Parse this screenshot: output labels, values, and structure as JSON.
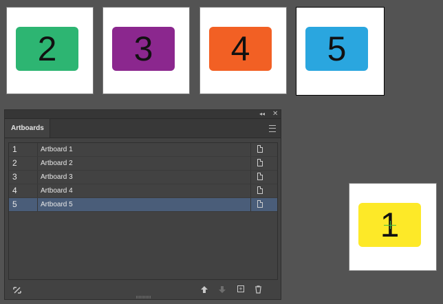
{
  "artboards": [
    {
      "label": "2",
      "color": "#2db572"
    },
    {
      "label": "3",
      "color": "#8b278e"
    },
    {
      "label": "4",
      "color": "#f26024"
    },
    {
      "label": "5",
      "color": "#2aa6df"
    },
    {
      "label": "1",
      "color": "#fde928"
    }
  ],
  "panel": {
    "tab_label": "Artboards",
    "collapse_glyph": "◂◂",
    "close_glyph": "✕",
    "rows": [
      {
        "num": "1",
        "name": "Artboard 1"
      },
      {
        "num": "2",
        "name": "Artboard 2"
      },
      {
        "num": "3",
        "name": "Artboard 3"
      },
      {
        "num": "4",
        "name": "Artboard 4"
      },
      {
        "num": "5",
        "name": "Artboard 5",
        "selected": true
      }
    ],
    "footer_icons": [
      "rearrange-icon",
      "move-up-icon",
      "move-down-icon",
      "new-artboard-icon",
      "delete-icon"
    ]
  }
}
